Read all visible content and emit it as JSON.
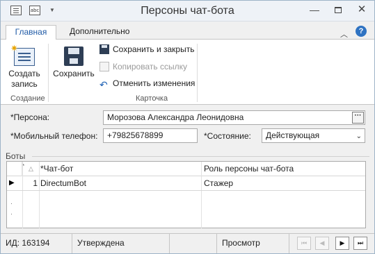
{
  "window": {
    "title": "Персоны чат-бота",
    "quick_access": {
      "abc_icon_text": "abc"
    }
  },
  "ribbon": {
    "tabs": [
      {
        "label": "Главная",
        "active": true
      },
      {
        "label": "Дополнительно",
        "active": false
      }
    ],
    "create_button_label_1": "Создать",
    "create_button_label_2": "запись",
    "save_button_label": "Сохранить",
    "save_close_label": "Сохранить и закрыть",
    "copy_link_label": "Копировать ссылку",
    "cancel_changes_label": "Отменить изменения",
    "group_create_label": "Создание",
    "group_card_label": "Карточка"
  },
  "form": {
    "person_label": "*Персона:",
    "person_value": "Морозова Александра Леонидовна",
    "phone_label": "*Мобильный телефон:",
    "phone_value": "+79825678899",
    "state_label": "*Состояние:",
    "state_value": "Действующая"
  },
  "bots": {
    "section_title": "Боты",
    "columns": {
      "required_mark": "*",
      "bot": "*Чат-бот",
      "role": "Роль персоны чат-бота"
    },
    "rows": [
      {
        "num": "1",
        "bot": "DirectumBot",
        "role": "Стажер"
      }
    ]
  },
  "status_bar": {
    "id_text": "ИД: 163194",
    "status_text": "Утверждена",
    "mode_text": "Просмотр"
  },
  "colors": {
    "accent": "#1f5aa6",
    "help": "#2f73c2",
    "disabled_text": "#9a9a9a"
  },
  "icons": [
    "doc-icon",
    "abc-icon",
    "dropdown-arrow-icon",
    "minimize-icon",
    "maximize-icon",
    "close-icon",
    "collapse-ribbon-icon",
    "help-icon",
    "create-record-icon",
    "save-icon",
    "save-close-icon",
    "copy-link-icon",
    "undo-icon",
    "ellipsis-icon",
    "chevron-down-icon",
    "nav-first-icon",
    "nav-prev-icon",
    "nav-next-icon",
    "nav-last-icon"
  ]
}
